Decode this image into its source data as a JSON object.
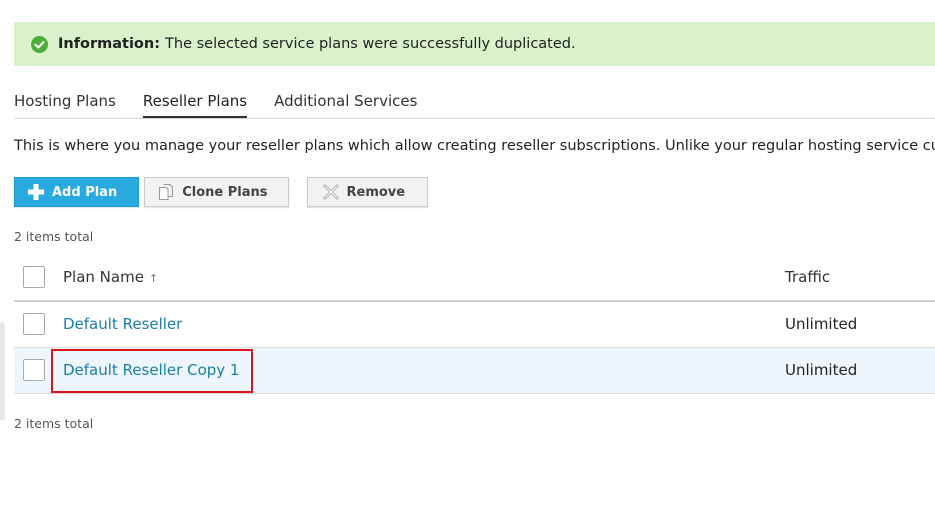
{
  "message": {
    "label": "Information:",
    "text": "The selected service plans were successfully duplicated.",
    "icon": "check-circle-icon",
    "background": "#d9f2cc"
  },
  "tabs": [
    {
      "label": "Hosting Plans",
      "active": false
    },
    {
      "label": "Reseller Plans",
      "active": true
    },
    {
      "label": "Additional Services",
      "active": false
    }
  ],
  "intro": "This is where you manage your reseller plans which allow creating reseller subscriptions. Unlike your regular hosting service cust",
  "toolbar": {
    "add_plan": "Add Plan",
    "clone_plans": "Clone Plans",
    "remove": "Remove"
  },
  "items_total_top": "2 items total",
  "items_total_bottom": "2 items total",
  "table": {
    "columns": {
      "name": "Plan Name",
      "sort_indicator": "↑",
      "traffic": "Traffic"
    },
    "rows": [
      {
        "name": "Default Reseller",
        "traffic": "Unlimited"
      },
      {
        "name": "Default Reseller Copy 1",
        "traffic": "Unlimited"
      }
    ]
  },
  "colors": {
    "accent": "#28aae1",
    "link": "#1a7fa6",
    "highlight": "#e0151b",
    "success_icon": "#4caf3a"
  }
}
